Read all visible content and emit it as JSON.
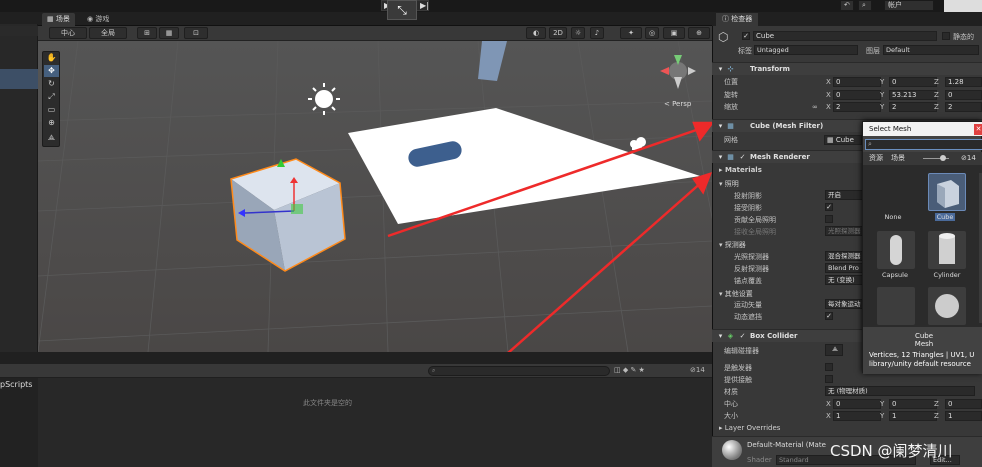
{
  "toolbar": {
    "account_label": "帐户",
    "play_icon": "play-icon",
    "pause_icon": "pause-icon",
    "step_icon": "step-icon"
  },
  "scene_tabs": [
    {
      "label": "场景"
    },
    {
      "label": "游戏"
    }
  ],
  "scene_toolbar": {
    "pivot": "中心",
    "space": "全局",
    "mode_2d": "2D",
    "persp_label": "< Persp"
  },
  "inspector": {
    "tab_label": "检查器",
    "object_name": "Cube",
    "static_label": "静态的",
    "tag_label": "标签",
    "tag_value": "Untagged",
    "layer_label": "图层",
    "layer_value": "Default",
    "transform": {
      "title": "Transform",
      "position_label": "位置",
      "rotation_label": "旋转",
      "scale_label": "缩放",
      "position": [
        "0",
        "0",
        "1.28"
      ],
      "rotation": [
        "0",
        "53.213",
        "0"
      ],
      "scale": [
        "2",
        "2",
        "2"
      ]
    },
    "mesh_filter": {
      "title": "Cube (Mesh Filter)",
      "mesh_label": "网格",
      "mesh_value": "Cube"
    },
    "mesh_renderer": {
      "title": "Mesh Renderer",
      "materials_label": "Materials",
      "lighting_label": "照明",
      "cast_shadows_label": "投射阴影",
      "cast_shadows_value": "开启",
      "receive_shadows_label": "接受阴影",
      "contribute_gi_label": "贡献全局照明",
      "receive_gi_label": "接收全局照明",
      "receive_gi_value": "光照探测器",
      "probes_label": "探测器",
      "light_probes_label": "光照探测器",
      "light_probes_value": "混合探测器",
      "reflection_probes_label": "反射探测器",
      "reflection_probes_value": "Blend Pro",
      "anchor_label": "锚点覆盖",
      "anchor_value": "无 (变换)",
      "other_label": "其他设置",
      "motion_vectors_label": "运动矢量",
      "motion_vectors_value": "每对象运动",
      "dynamic_occlusion_label": "动态遮挡"
    },
    "box_collider": {
      "title": "Box Collider",
      "edit_label": "编辑碰撞器",
      "trigger_label": "是触发器",
      "contact_label": "提供接触",
      "material_label": "材质",
      "material_value": "无 (物理材质)",
      "center_label": "中心",
      "center": [
        "0",
        "0",
        "0"
      ],
      "size_label": "大小",
      "size": [
        "1",
        "1",
        "1"
      ],
      "layer_overrides_label": "Layer Overrides"
    },
    "material": {
      "name": "Default-Material (Mate",
      "shader_label": "Shader",
      "shader_value": "Standard",
      "edit_label": "Edit..."
    }
  },
  "select_mesh": {
    "title": "Select Mesh",
    "tabs": [
      "资源",
      "场景"
    ],
    "count": "14",
    "items": [
      {
        "label": "None"
      },
      {
        "label": "Cube"
      },
      {
        "label": "Capsule"
      },
      {
        "label": "Cylinder"
      },
      {
        "label": ""
      },
      {
        "label": ""
      }
    ],
    "selected_name": "Cube",
    "selected_type": "Mesh",
    "info_line1": "Vertices, 12 Triangles | UV1, U",
    "info_line2": "library/unity default resource"
  },
  "project": {
    "folder": "pScripts",
    "empty_message": "此文件夹是空的",
    "count": "14"
  },
  "watermark": "CSDN @阑梦清川",
  "colors": {
    "accent": "#46607f",
    "selection": "#3d4f66",
    "arrow": "#ee2a2a",
    "outline": "#ff8a1a"
  }
}
